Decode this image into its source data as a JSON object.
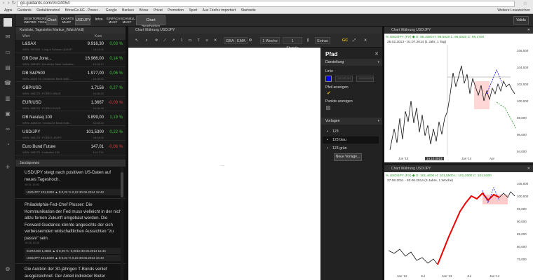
{
  "browser": {
    "url": "go.guidants.com/#c/24054",
    "bookmarks": [
      "Apps",
      "Guidants",
      "Redaktionstool",
      "BörseGo AG - Power...",
      "Google",
      "Banken",
      "Börse",
      "Privat",
      "Promotion",
      "Sport",
      "Aus Firefox importiert",
      "Startseite"
    ],
    "other_bookmarks": "Weitere Lesezeichen"
  },
  "topnav": {
    "buttons": [
      {
        "l1": "DESKTOP",
        "l2": "WEITER"
      },
      {
        "l1": "SCREEN",
        "l2": "TOOLS"
      },
      {
        "l1": "Chart",
        "l2": ""
      },
      {
        "l1": "CHARTS",
        "l2": "MUST"
      },
      {
        "l1": "USDJPY",
        "l2": ""
      },
      {
        "l1": "Intra",
        "l2": ""
      },
      {
        "l1": "EINFACH",
        "l2": "MUST"
      },
      {
        "l1": "SCHNELL",
        "l2": "MUST"
      },
      {
        "l1": "Chart bearbeiten",
        "l2": ""
      }
    ],
    "login": "Valida"
  },
  "watchlist": {
    "title": "Kursliste, Tagesinfos Markus_(WatchVoll)",
    "col_name": "Wert",
    "col_price": "Kurs",
    "rows": [
      {
        "name": "L&SAX",
        "sub": "WKN: 967583 / Lang & Schwarz (DAXP",
        "price": "9.916,30",
        "time": "16:18:11",
        "change": "0,03 %",
        "dir": "pos"
      },
      {
        "name": "DB Dow Jone...",
        "sub": "WKN: 969420 / Deutsche Bank Indikation",
        "price": "16.966,00",
        "time": "16:18:17",
        "change": "0,14 %",
        "dir": "pos"
      },
      {
        "name": "DB S&P500",
        "sub": "WKN: A0AET0 / Deutsche Bank Indik...",
        "price": "1.977,00",
        "time": "16:18:21",
        "change": "0,06 %",
        "dir": "pos"
      },
      {
        "name": "GBP/USD",
        "sub": "WKN: 965275 / FOREX.GBUS",
        "price": "1,7156",
        "time": "16:18:22",
        "change": "0,27 %",
        "dir": "pos"
      },
      {
        "name": "EUR/USD",
        "sub": "WKN: 965275 / FOREX.EUUS",
        "price": "1,3667",
        "time": "16:18:40",
        "change": "-0,09 %",
        "dir": "neg"
      },
      {
        "name": "DB Nasdaq 100",
        "sub": "WKN: A0AE1X / Deutsche Bank Indik...",
        "price": "3.899,00",
        "time": "16:18:22",
        "change": "1,19 %",
        "dir": "pos"
      },
      {
        "name": "USD/JPY",
        "sub": "WKN: 965275 / FOREX.USJPY",
        "price": "101,5300",
        "time": "16:18:11",
        "change": "0,22 %",
        "dir": "pos"
      },
      {
        "name": "Euro Bund Future",
        "sub": "WKN: 965275 / Indikation 100",
        "price": "147,01",
        "time": "16:17:51",
        "change": "-0,06 %",
        "dir": "neg"
      }
    ]
  },
  "news": {
    "title": "Jandapsewa",
    "items": [
      {
        "text": "USD/JPY steigt nach positiven US-Daten auf neues Tageshoch.",
        "time": "16:31 16:43"
      },
      {
        "quote": "USD/JPY   101,5300  ▲ $  0,22 %   0,23   30.06.2014 16:43"
      },
      {
        "text": "Philadelphia-Fed-Chef Plosser: Die Kommunikation der Fed muss vielleicht in der nicht allzu fernen Zukunft umgebaut werden. Die Forward Guidance könnte angesichts der sich verbessernden wirtschaftlichen Aussichten \"zu passiv\" sein.",
        "time": "16:38 16:46"
      },
      {
        "quote": "EUR/USD   1,3682  ▲ $  0,09 %   -0,0010   30.06.2014 16:43"
      },
      {
        "quote": "USD/JPY   101,5300  ▲ $  0,22 %   0,23   30.06.2014 16:43"
      },
      {
        "text": "Die Auktion der 30-jährigen T-Bonds verlief ausgezeichnet. Der Anteil indirekter Bieter",
        "time": ""
      }
    ]
  },
  "main_chart": {
    "title": "Chart Währung USD/JPY",
    "toolbar": {
      "indicators": [
        "GBA",
        "EMA"
      ],
      "timeframe": "1 Woche",
      "interval": "1 Stunde",
      "extras": "Extras"
    },
    "loading": "---"
  },
  "pfad_panel": {
    "title": "Pfad",
    "section_display": "Darstellung",
    "line_label": "Linie",
    "line_style_1": "— — —",
    "line_style_2": "————",
    "show_path_label": "Pfeil anzeigen",
    "show_points_label": "Punkte anzeigen",
    "templates_label": "Vorlagen",
    "templates": [
      "123",
      "123 blau",
      "123 grün"
    ],
    "selected_template_index": 1,
    "new_template_button": "Neue Vorlage...",
    "accent_color": "#0000ee"
  },
  "right_chart_top": {
    "title": "Chart Währung USD/JPY",
    "legend_line1": "% USD/JPY (FX)  ◆  O: 98,1050  H: 98,5020  L: 98,0020  C: 98,1700",
    "legend_line2": "25.02.2013 - 01.07.2014 (1 Jahr, 1 Tag)",
    "y_ticks": [
      "106,000",
      "104,000",
      "102,000",
      "100,000",
      "98,000",
      "96,000",
      "94,000"
    ],
    "x_ticks": [
      "Jun '13",
      "Jan '14",
      "Apr"
    ],
    "date_label": "14.10.2013"
  },
  "right_chart_bottom": {
    "title": "Chart Währung USD/JPY",
    "legend_line1": "% USD/JPY (FX)  ◆  O: 101,4600  H: 101,5500  L: 101,2600  C: 101,5300",
    "legend_line2": "27.06.2011 - 30.06.2014 (3 Jahre, 1 Woche)",
    "y_ticks": [
      "105,000",
      "100,000",
      "95,000",
      "90,000",
      "85,000",
      "80,000",
      "75,000"
    ],
    "x_ticks": [
      "Jan '12",
      "Jul",
      "Jan '13",
      "Jul",
      "Jan '14"
    ]
  }
}
